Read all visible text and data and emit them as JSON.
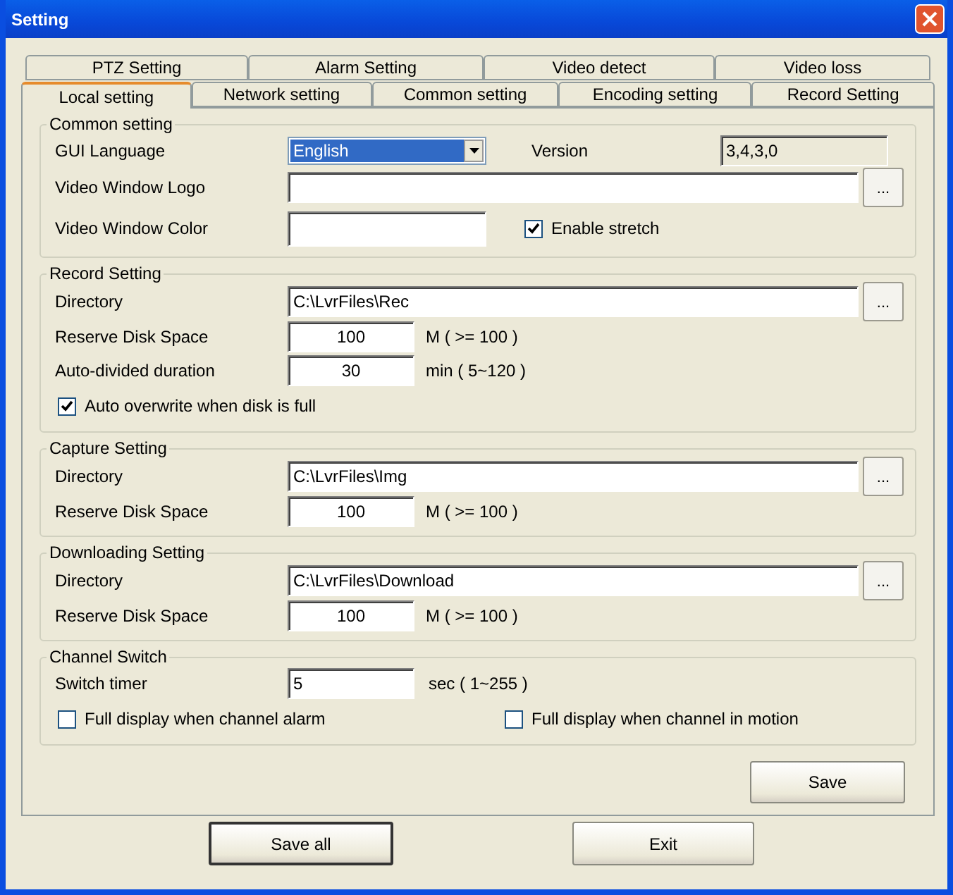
{
  "window": {
    "title": "Setting"
  },
  "tab_rows": [
    [
      {
        "label": "PTZ Setting",
        "selected": false
      },
      {
        "label": "Alarm Setting",
        "selected": false
      },
      {
        "label": "Video detect",
        "selected": false
      },
      {
        "label": "Video loss",
        "selected": false
      }
    ],
    [
      {
        "label": "Local setting",
        "selected": true
      },
      {
        "label": "Network setting",
        "selected": false
      },
      {
        "label": "Common setting",
        "selected": false
      },
      {
        "label": "Encoding setting",
        "selected": false
      },
      {
        "label": "Record Setting",
        "selected": false
      }
    ]
  ],
  "common": {
    "title": "Common setting",
    "gui_language": {
      "label": "GUI Language",
      "value": "English"
    },
    "version": {
      "label": "Version",
      "value": "3,4,3,0"
    },
    "logo": {
      "label": "Video Window Logo",
      "browse": "..."
    },
    "color": {
      "label": "Video Window Color"
    },
    "stretch": {
      "label": "Enable stretch",
      "checked": true
    }
  },
  "sections": [
    {
      "title": "Record Setting",
      "rows": [
        {
          "kind": "path",
          "label": "Directory",
          "value": "C:\\LvrFiles\\Rec",
          "browse": "..."
        },
        {
          "kind": "number",
          "label": "Reserve Disk Space",
          "value": "100",
          "unit": "M ( >= 100 )"
        },
        {
          "kind": "number",
          "label": "Auto-divided duration",
          "value": "30",
          "unit": "min ( 5~120 )"
        },
        {
          "kind": "checks",
          "items": [
            {
              "label": "Auto overwrite when disk is full",
              "checked": true
            }
          ]
        }
      ]
    },
    {
      "title": "Capture Setting",
      "rows": [
        {
          "kind": "path",
          "label": "Directory",
          "value": "C:\\LvrFiles\\Img",
          "browse": "..."
        },
        {
          "kind": "number",
          "label": "Reserve Disk Space",
          "value": "100",
          "unit": "M ( >= 100 )"
        }
      ]
    },
    {
      "title": "Downloading Setting",
      "rows": [
        {
          "kind": "path",
          "label": "Directory",
          "value": "C:\\LvrFiles\\Download",
          "browse": "..."
        },
        {
          "kind": "number",
          "label": "Reserve Disk Space",
          "value": "100",
          "unit": "M ( >= 100 )"
        }
      ]
    },
    {
      "title": "Channel Switch",
      "rows": [
        {
          "kind": "timer",
          "label": "Switch timer",
          "value": "5",
          "unit": "sec ( 1~255 )"
        },
        {
          "kind": "checks",
          "items": [
            {
              "label": "Full display when channel alarm",
              "checked": false
            },
            {
              "label": "Full display when channel in motion",
              "checked": false
            }
          ]
        }
      ]
    }
  ],
  "save": {
    "label": "Save"
  },
  "buttons": [
    {
      "label": "Save all",
      "default": true
    },
    {
      "label": "Exit",
      "default": false
    }
  ]
}
